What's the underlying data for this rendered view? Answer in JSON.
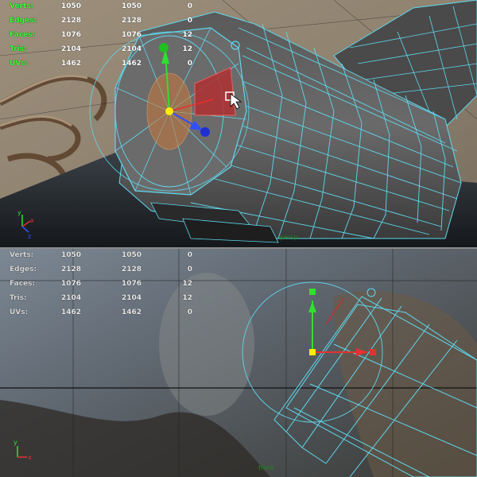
{
  "top_viewport": {
    "stats": [
      {
        "label": "Verts:",
        "v1": "1050",
        "v2": "1050",
        "v3": "0"
      },
      {
        "label": "Edges:",
        "v1": "2128",
        "v2": "2128",
        "v3": "0"
      },
      {
        "label": "Faces:",
        "v1": "1076",
        "v2": "1076",
        "v3": "12"
      },
      {
        "label": "Tris:",
        "v1": "2104",
        "v2": "2104",
        "v3": "12"
      },
      {
        "label": "UVs:",
        "v1": "1462",
        "v2": "1462",
        "v3": "0"
      }
    ],
    "camera_label": "persp",
    "axis_colors": {
      "x": "#e83030",
      "y": "#30e030",
      "z": "#3050ff"
    }
  },
  "bottom_viewport": {
    "stats": [
      {
        "label": "Verts:",
        "v1": "1050",
        "v2": "1050",
        "v3": "0"
      },
      {
        "label": "Edges:",
        "v1": "2128",
        "v2": "2128",
        "v3": "0"
      },
      {
        "label": "Faces:",
        "v1": "1076",
        "v2": "1076",
        "v3": "12"
      },
      {
        "label": "Tris:",
        "v1": "2104",
        "v2": "2104",
        "v3": "12"
      },
      {
        "label": "UVs:",
        "v1": "1462",
        "v2": "1462",
        "v3": "0"
      }
    ],
    "camera_label": "front"
  },
  "colors": {
    "wireframe": "#5fd8ee",
    "selected_face": "#b03030",
    "pivot": "#ffee00"
  }
}
